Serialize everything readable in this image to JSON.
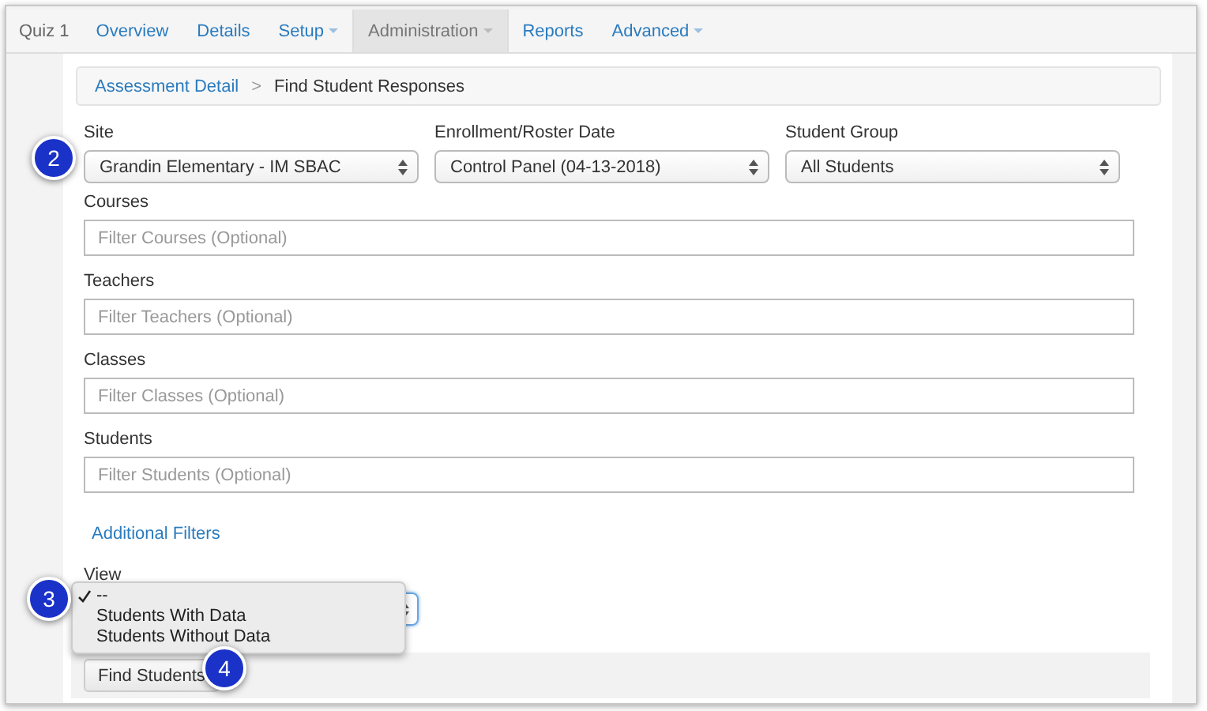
{
  "page_title": "Quiz 1",
  "tabs": [
    {
      "label": "Overview",
      "selected": false,
      "dropdown": false
    },
    {
      "label": "Details",
      "selected": false,
      "dropdown": false
    },
    {
      "label": "Setup",
      "selected": false,
      "dropdown": true
    },
    {
      "label": "Administration",
      "selected": true,
      "dropdown": true
    },
    {
      "label": "Reports",
      "selected": false,
      "dropdown": false
    },
    {
      "label": "Advanced",
      "selected": false,
      "dropdown": true
    }
  ],
  "breadcrumb": {
    "link": "Assessment Detail",
    "separator": ">",
    "current": "Find Student Responses"
  },
  "selects": [
    {
      "label": "Site",
      "value": "Grandin Elementary - IM SBAC"
    },
    {
      "label": "Enrollment/Roster Date",
      "value": "Control Panel (04-13-2018)"
    },
    {
      "label": "Student Group",
      "value": "All Students"
    }
  ],
  "filters": [
    {
      "label": "Courses",
      "placeholder": "Filter Courses (Optional)"
    },
    {
      "label": "Teachers",
      "placeholder": "Filter Teachers (Optional)"
    },
    {
      "label": "Classes",
      "placeholder": "Filter Classes (Optional)"
    },
    {
      "label": "Students",
      "placeholder": "Filter Students (Optional)"
    }
  ],
  "additional_filters": "Additional Filters",
  "view": {
    "label": "View",
    "options": [
      {
        "label": "--",
        "selected": true
      },
      {
        "label": "Students With Data",
        "selected": false
      },
      {
        "label": "Students Without Data",
        "selected": false
      }
    ]
  },
  "find_button": "Find Students",
  "callouts": [
    "2",
    "3",
    "4"
  ]
}
